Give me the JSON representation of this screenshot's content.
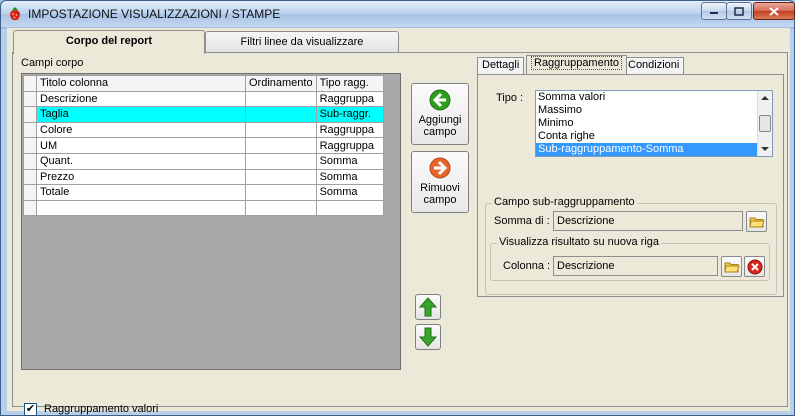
{
  "window": {
    "title": "IMPOSTAZIONE VISUALIZZAZIONI / STAMPE",
    "icon": "strawberry-icon",
    "controls": [
      "minimize-icon",
      "maximize-icon",
      "close-icon"
    ]
  },
  "tabs": [
    {
      "label": "Corpo del report",
      "active": true
    },
    {
      "label": "Filtri linee da visualizzare",
      "active": false
    }
  ],
  "left": {
    "section_label": "Campi corpo",
    "columns": [
      "Titolo colonna",
      "Ordinamento",
      "Tipo ragg."
    ],
    "rows": [
      {
        "titolo": "Descrizione",
        "ordinamento": "",
        "tipo": "Raggruppa",
        "selected": false
      },
      {
        "titolo": "Taglia",
        "ordinamento": "",
        "tipo": "Sub-raggr.",
        "selected": true
      },
      {
        "titolo": "Colore",
        "ordinamento": "",
        "tipo": "Raggruppa",
        "selected": false
      },
      {
        "titolo": "UM",
        "ordinamento": "",
        "tipo": "Raggruppa",
        "selected": false
      },
      {
        "titolo": "Quant.",
        "ordinamento": "",
        "tipo": "Somma",
        "selected": false
      },
      {
        "titolo": "Prezzo",
        "ordinamento": "",
        "tipo": "Somma",
        "selected": false
      },
      {
        "titolo": "Totale",
        "ordinamento": "",
        "tipo": "Somma",
        "selected": false
      },
      {
        "titolo": "",
        "ordinamento": "",
        "tipo": "",
        "selected": false
      }
    ],
    "checkbox": {
      "label": "Raggruppamento valori",
      "checked": true,
      "mark": "✔"
    }
  },
  "buttons": {
    "add_line1": "Aggiungi",
    "add_line2": "campo",
    "remove_line1": "Rimuovi",
    "remove_line2": "campo"
  },
  "right": {
    "tabs": [
      {
        "label": "Dettagli",
        "active": false
      },
      {
        "label": "Raggruppamento",
        "active": true
      },
      {
        "label": "Condizioni",
        "active": false
      }
    ],
    "tipo_label": "Tipo :",
    "tipo_options": [
      "Somma valori",
      "Massimo",
      "Minimo",
      "Conta righe",
      "Sub-raggruppamento-Somma"
    ],
    "tipo_selected": "Sub-raggruppamento-Somma",
    "group_sub_title": "Campo sub-raggruppamento",
    "somma_label": "Somma di :",
    "somma_value": "Descrizione",
    "group_newrow_title": "Visualizza risultato su nuova riga",
    "colonna_label": "Colonna :",
    "colonna_value": "Descrizione"
  },
  "colors": {
    "selection": "#00ffff",
    "list_selection": "#3399ff",
    "add_icon": "#2e9e1f",
    "remove_icon": "#e8642a",
    "arrow_icon": "#3aa52b"
  }
}
